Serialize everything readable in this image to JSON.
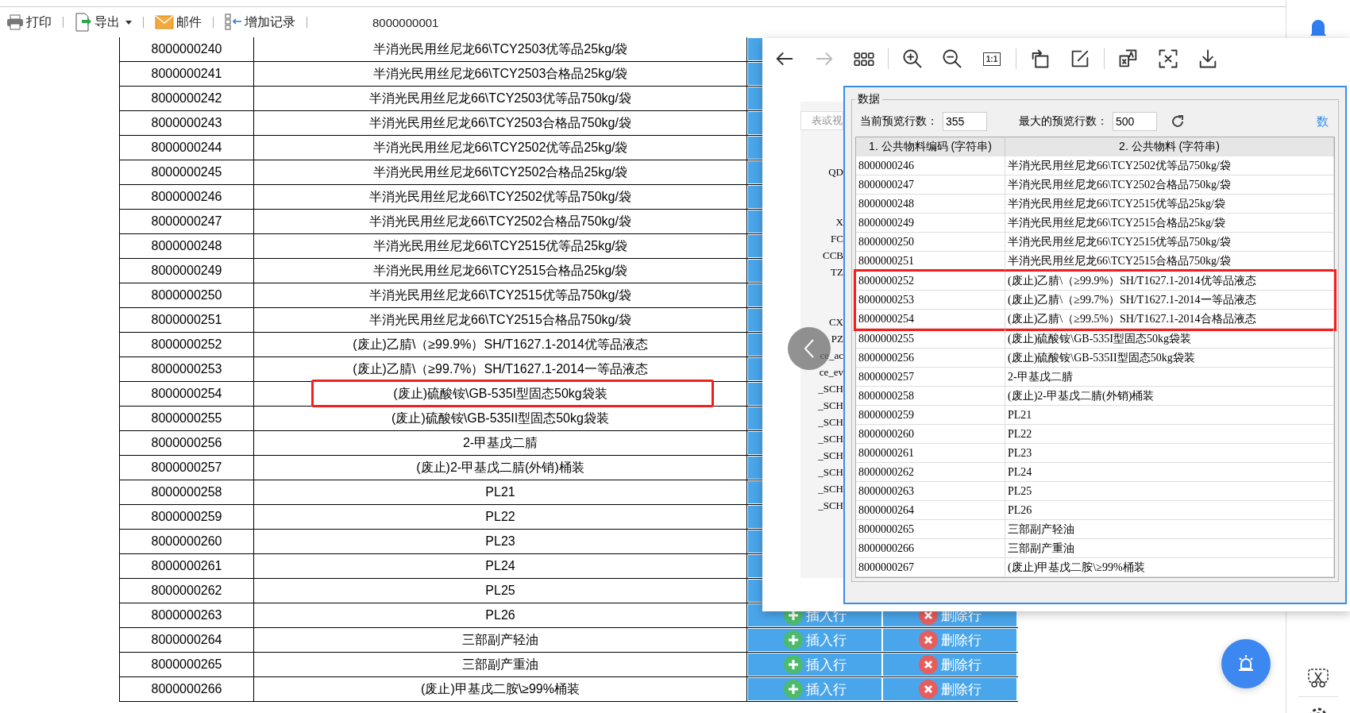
{
  "toolbar": {
    "items": [
      {
        "kind": "print",
        "label": "打印",
        "dropdown": false
      },
      {
        "kind": "export",
        "label": "导出",
        "dropdown": true
      },
      {
        "kind": "mail",
        "label": "邮件",
        "dropdown": false
      },
      {
        "kind": "add",
        "label": "增加记录",
        "dropdown": false
      }
    ],
    "record_code": "8000000001"
  },
  "table": {
    "rows": [
      {
        "code": "8000000240",
        "name": "半消光民用丝尼龙66\\TCY2503优等品25kg/袋",
        "annotated": false
      },
      {
        "code": "8000000241",
        "name": "半消光民用丝尼龙66\\TCY2503合格品25kg/袋",
        "annotated": false
      },
      {
        "code": "8000000242",
        "name": "半消光民用丝尼龙66\\TCY2503优等品750kg/袋",
        "annotated": false
      },
      {
        "code": "8000000243",
        "name": "半消光民用丝尼龙66\\TCY2503合格品750kg/袋",
        "annotated": false
      },
      {
        "code": "8000000244",
        "name": "半消光民用丝尼龙66\\TCY2502优等品25kg/袋",
        "annotated": false
      },
      {
        "code": "8000000245",
        "name": "半消光民用丝尼龙66\\TCY2502合格品25kg/袋",
        "annotated": false
      },
      {
        "code": "8000000246",
        "name": "半消光民用丝尼龙66\\TCY2502优等品750kg/袋",
        "annotated": false
      },
      {
        "code": "8000000247",
        "name": "半消光民用丝尼龙66\\TCY2502合格品750kg/袋",
        "annotated": false
      },
      {
        "code": "8000000248",
        "name": "半消光民用丝尼龙66\\TCY2515优等品25kg/袋",
        "annotated": false
      },
      {
        "code": "8000000249",
        "name": "半消光民用丝尼龙66\\TCY2515合格品25kg/袋",
        "annotated": false
      },
      {
        "code": "8000000250",
        "name": "半消光民用丝尼龙66\\TCY2515优等品750kg/袋",
        "annotated": false
      },
      {
        "code": "8000000251",
        "name": "半消光民用丝尼龙66\\TCY2515合格品750kg/袋",
        "annotated": false
      },
      {
        "code": "8000000252",
        "name": "(废止)乙腈\\（≥99.9%）SH/T1627.1-2014优等品液态",
        "annotated": false
      },
      {
        "code": "8000000253",
        "name": "(废止)乙腈\\（≥99.7%）SH/T1627.1-2014一等品液态",
        "annotated": false
      },
      {
        "code": "8000000254",
        "name": "(废止)硫酸铵\\GB-535I型固态50kg袋装",
        "annotated": true
      },
      {
        "code": "8000000255",
        "name": "(废止)硫酸铵\\GB-535II型固态50kg袋装",
        "annotated": false
      },
      {
        "code": "8000000256",
        "name": "2-甲基戊二腈",
        "annotated": false
      },
      {
        "code": "8000000257",
        "name": "(废止)2-甲基戊二腈(外销)桶装",
        "annotated": false
      },
      {
        "code": "8000000258",
        "name": "PL21",
        "annotated": false
      },
      {
        "code": "8000000259",
        "name": "PL22",
        "annotated": false
      },
      {
        "code": "8000000260",
        "name": "PL23",
        "annotated": false
      },
      {
        "code": "8000000261",
        "name": "PL24",
        "annotated": false
      },
      {
        "code": "8000000262",
        "name": "PL25",
        "annotated": false
      },
      {
        "code": "8000000263",
        "name": "PL26",
        "annotated": false,
        "insert_label": "插入行",
        "delete_label": "删除行"
      },
      {
        "code": "8000000264",
        "name": "三部副产轻油",
        "annotated": false,
        "insert_label": "插入行",
        "delete_label": "删除行"
      },
      {
        "code": "8000000265",
        "name": "三部副产重油",
        "annotated": false,
        "insert_label": "插入行",
        "delete_label": "删除行"
      },
      {
        "code": "8000000266",
        "name": "(废止)甲基戊二胺\\≥99%桶装",
        "annotated": false,
        "insert_label": "插入行",
        "delete_label": "删除行"
      }
    ]
  },
  "viewer": {
    "tool_groups": [
      [
        {
          "kind": "back",
          "disabled": false
        },
        {
          "kind": "forward",
          "disabled": true
        },
        {
          "kind": "grid",
          "disabled": false
        }
      ],
      [
        {
          "kind": "zoom-in",
          "disabled": false
        },
        {
          "kind": "zoom-out",
          "disabled": false
        },
        {
          "kind": "actual-size",
          "label": "1:1",
          "disabled": false
        }
      ],
      [
        {
          "kind": "rotate",
          "disabled": false
        },
        {
          "kind": "edit",
          "disabled": false
        }
      ],
      [
        {
          "kind": "translate",
          "disabled": false
        },
        {
          "kind": "ocr",
          "disabled": false
        },
        {
          "kind": "download",
          "disabled": false
        }
      ]
    ],
    "background_window": {
      "search_placeholder": "表或视",
      "fragment_groups": [
        [
          "QD"
        ],
        [
          "X",
          "FC",
          "CCB",
          "TZ"
        ],
        [
          "CX",
          "PZ",
          "ce_ac",
          "ce_ev",
          "_SCH",
          "_SCH",
          "_SCH",
          "_SCH",
          "_SCH",
          "_SCH",
          "_SCH",
          "_SCH"
        ]
      ]
    },
    "dialog": {
      "group_title": "数据",
      "current_rows_label": "当前预览行数：",
      "current_rows_value": "355",
      "max_rows_label": "最大的预览行数：",
      "max_rows_value": "500",
      "link": "数",
      "columns": [
        "1. 公共物料编码 (字符串)",
        "2. 公共物料 (字符串)"
      ],
      "rows": [
        {
          "code": "8000000246",
          "name": "半消光民用丝尼龙66\\TCY2502优等品750kg/袋",
          "marked": false
        },
        {
          "code": "8000000247",
          "name": "半消光民用丝尼龙66\\TCY2502合格品750kg/袋",
          "marked": false
        },
        {
          "code": "8000000248",
          "name": "半消光民用丝尼龙66\\TCY2515优等品25kg/袋",
          "marked": false
        },
        {
          "code": "8000000249",
          "name": "半消光民用丝尼龙66\\TCY2515合格品25kg/袋",
          "marked": false
        },
        {
          "code": "8000000250",
          "name": "半消光民用丝尼龙66\\TCY2515优等品750kg/袋",
          "marked": false
        },
        {
          "code": "8000000251",
          "name": "半消光民用丝尼龙66\\TCY2515合格品750kg/袋",
          "marked": false
        },
        {
          "code": "8000000252",
          "name": "(废止)乙腈\\（≥99.9%）SH/T1627.1-2014优等品液态",
          "marked": true
        },
        {
          "code": "8000000253",
          "name": "(废止)乙腈\\（≥99.7%）SH/T1627.1-2014一等品液态",
          "marked": true
        },
        {
          "code": "8000000254",
          "name": "(废止)乙腈\\（≥99.5%）SH/T1627.1-2014合格品液态",
          "marked": true
        },
        {
          "code": "8000000255",
          "name": "(废止)硫酸铵\\GB-535I型固态50kg袋装",
          "marked": false
        },
        {
          "code": "8000000256",
          "name": "(废止)硫酸铵\\GB-535II型固态50kg袋装",
          "marked": false
        },
        {
          "code": "8000000257",
          "name": "2-甲基戊二腈",
          "marked": false
        },
        {
          "code": "8000000258",
          "name": "(废止)2-甲基戊二腈(外销)桶装",
          "marked": false
        },
        {
          "code": "8000000259",
          "name": "PL21",
          "marked": false
        },
        {
          "code": "8000000260",
          "name": "PL22",
          "marked": false
        },
        {
          "code": "8000000261",
          "name": "PL23",
          "marked": false
        },
        {
          "code": "8000000262",
          "name": "PL24",
          "marked": false
        },
        {
          "code": "8000000263",
          "name": "PL25",
          "marked": false
        },
        {
          "code": "8000000264",
          "name": "PL26",
          "marked": false
        },
        {
          "code": "8000000265",
          "name": "三部副产轻油",
          "marked": false
        },
        {
          "code": "8000000266",
          "name": "三部副产重油",
          "marked": false
        },
        {
          "code": "8000000267",
          "name": "(废止)甲基戊二胺\\≥99%桶装",
          "marked": false
        }
      ]
    }
  }
}
